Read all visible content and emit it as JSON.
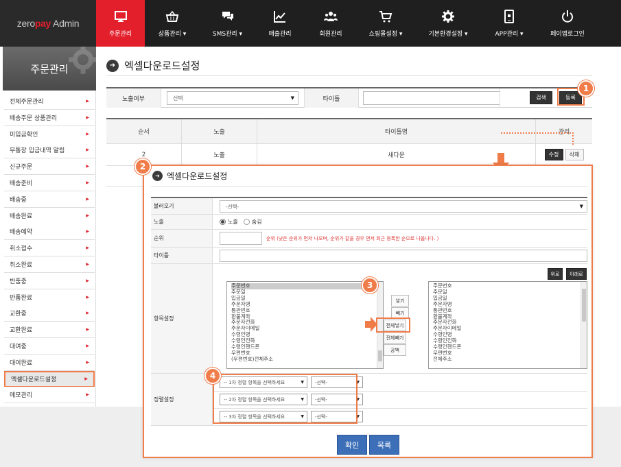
{
  "logo": {
    "part1": "zero",
    "part2": "pay",
    "part3": "Admin"
  },
  "nav": [
    {
      "label": "주문관리",
      "icon": "monitor-icon",
      "active": true
    },
    {
      "label": "상품관리 ▾",
      "icon": "basket-icon"
    },
    {
      "label": "SMS관리 ▾",
      "icon": "chat-icon"
    },
    {
      "label": "매출관리",
      "icon": "chart-icon"
    },
    {
      "label": "회원관리",
      "icon": "users-icon"
    },
    {
      "label": "쇼핑몰설정 ▾",
      "icon": "cart-icon"
    },
    {
      "label": "기본환경설정 ▾",
      "icon": "gear-icon"
    },
    {
      "label": "APP관리 ▾",
      "icon": "mobile-icon"
    },
    {
      "label": "페이앱로그인",
      "icon": "power-icon"
    }
  ],
  "sidebar": {
    "title": "주문관리",
    "items": [
      "전체주문관리",
      "배송주문 상품관리",
      "미입금확인",
      "무통장 입금내역 알림",
      "신규주문",
      "배송준비",
      "배송중",
      "배송완료",
      "배송예약",
      "취소접수",
      "취소완료",
      "반품중",
      "반품완료",
      "교환중",
      "교환완료",
      "대여중",
      "대여완료",
      "엑셀다운로드설정",
      "메모관리"
    ],
    "active_index": 17
  },
  "page": {
    "title": "엑셀다운로드설정"
  },
  "filter": {
    "exposure_label": "노출여부",
    "exposure_value": "선택",
    "title_label": "타이틀",
    "search_btn": "검색",
    "register_btn": "등록"
  },
  "list": {
    "headers": [
      "순서",
      "노출",
      "타이틀명",
      "관리"
    ],
    "row": {
      "order": "2",
      "exposure": "노출",
      "title": "새다운",
      "edit": "수정",
      "delete": "삭제"
    }
  },
  "badges": [
    "1",
    "2",
    "3",
    "4"
  ],
  "modal": {
    "title": "엑셀다운로드설정",
    "load_label": "불러오기",
    "load_value": "-선택-",
    "exposure_label": "노출",
    "show": "노출",
    "hide": "숨김",
    "rank_label": "순위",
    "rank_hint": "순위 (낮은 순위가 먼저 나오며, 순위가 같을 경우 먼저 최근 등록한 순으로 나옵니다. )",
    "title_label": "타이틀",
    "fields_label": "항목설정",
    "up_btn": "위로",
    "down_btn": "아래로",
    "left_items": [
      "주문번호",
      "주문일",
      "입금일",
      "주문자명",
      "통관번호",
      "환불계좌",
      "주문자전화",
      "주문자이메일",
      "수령인명",
      "수령인전화",
      "수령인핸드폰",
      "우편번호",
      "(우편번호)전체주소"
    ],
    "right_items": [
      "주문번호",
      "주문일",
      "입금일",
      "주문자명",
      "통관번호",
      "환불계좌",
      "주문자전화",
      "주문자이메일",
      "수령인명",
      "수령인전화",
      "수령인핸드폰",
      "우편번호",
      "전체주소"
    ],
    "transfer_btns": [
      "넣기",
      "빼기",
      "전체넣기",
      "전체빼기",
      "공백"
    ],
    "sort_label": "정렬설정",
    "sort_rows": [
      {
        "field": "-- 1차 정렬 항목을 선택하세요",
        "order": "-선택-"
      },
      {
        "field": "-- 2차 정렬 항목을 선택하세요",
        "order": "-선택-"
      },
      {
        "field": "-- 3차 정렬 항목을 선택하세요",
        "order": "-선택-"
      }
    ],
    "confirm_btn": "확인",
    "list_btn": "목록"
  }
}
